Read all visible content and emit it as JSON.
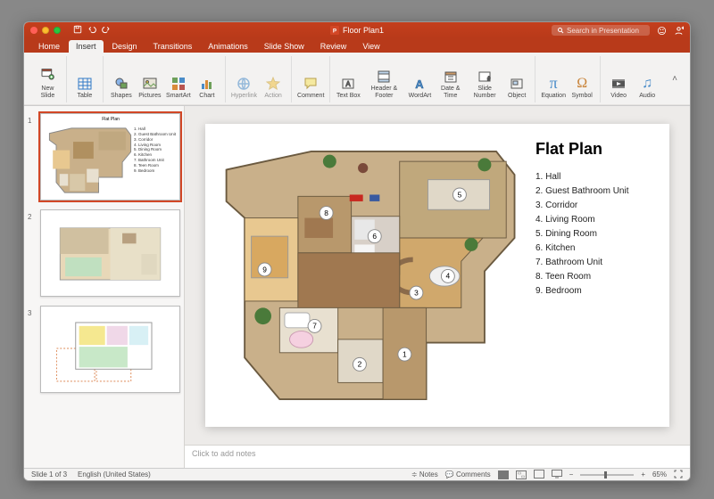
{
  "window": {
    "title": "Floor Plan1"
  },
  "titlebar": {
    "search_placeholder": "Search in Presentation"
  },
  "tabs": [
    "Home",
    "Insert",
    "Design",
    "Transitions",
    "Animations",
    "Slide Show",
    "Review",
    "View"
  ],
  "tabs_active_index": 1,
  "ribbon": {
    "new_slide": "New\nSlide",
    "table": "Table",
    "shapes": "Shapes",
    "pictures": "Pictures",
    "smartart": "SmartArt",
    "chart": "Chart",
    "hyperlink": "Hyperlink",
    "action": "Action",
    "comment": "Comment",
    "textbox": "Text\nBox",
    "header": "Header &\nFooter",
    "wordart": "WordArt",
    "date": "Date &\nTime",
    "slidenum": "Slide\nNumber",
    "object": "Object",
    "equation": "Equation",
    "symbol": "Symbol",
    "video": "Video",
    "audio": "Audio"
  },
  "thumbnails": [
    {
      "num": "1",
      "title": "Flat Plan"
    },
    {
      "num": "2",
      "title": ""
    },
    {
      "num": "3",
      "title": ""
    }
  ],
  "slide": {
    "title": "Flat Plan",
    "rooms": [
      "1. Hall",
      "2. Guest Bathroom Unit",
      "3. Corridor",
      "4. Living Room",
      "5. Dining Room",
      "6. Kitchen",
      "7. Bathroom Unit",
      "8. Teen Room",
      "9. Bedroom"
    ],
    "mini_rooms": [
      "1. Hall",
      "2. Guest Bathroom Unit",
      "3. Corridor",
      "4. Living Room",
      "5. Dining Room",
      "6. Kitchen",
      "7. Bathroom Unit",
      "8. Teen Room",
      "9. Bedroom"
    ],
    "markers": {
      "r1": "1",
      "r2": "2",
      "r3": "3",
      "r4": "4",
      "r5": "5",
      "r6": "6",
      "r7": "7",
      "r8": "8",
      "r9": "9"
    }
  },
  "notes_placeholder": "Click to add notes",
  "status": {
    "slide": "Slide 1 of 3",
    "lang": "English (United States)",
    "notes": "Notes",
    "comments": "Comments",
    "zoom": "65%"
  },
  "colors": {
    "accent": "#D24726",
    "ribbon": "#B83A1A"
  }
}
